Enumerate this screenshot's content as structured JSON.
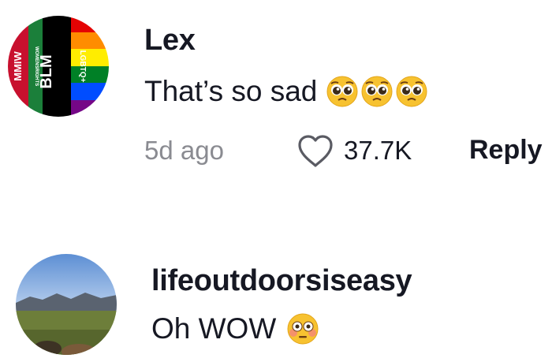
{
  "comments": [
    {
      "username": "Lex",
      "text": "That’s so sad",
      "emojis": [
        "pleading-face",
        "pleading-face",
        "pleading-face"
      ],
      "age": "5d ago",
      "likes": "37.7K",
      "reply_label": "Reply",
      "avatar": {
        "type": "flag-collage",
        "texts": [
          "MMIW",
          "BLM",
          "LGBTQ+",
          "WOMENSRIGHTS"
        ],
        "colors": [
          "#c8102e",
          "#1b7f3a",
          "#000000",
          "#e40303",
          "#ff8c00",
          "#ffed00",
          "#008026",
          "#004dff",
          "#750787"
        ]
      }
    },
    {
      "username": "lifeoutdoorsiseasy",
      "text": "Oh WOW",
      "emojis": [
        "flushed-face"
      ],
      "avatar": {
        "type": "landscape-photo",
        "colors": [
          "#6f9bd8",
          "#a8c4e8",
          "#56606e",
          "#6d7e3a",
          "#4f5d2c"
        ]
      }
    }
  ],
  "icons": {
    "like": "heart-outline-icon"
  },
  "colors": {
    "text_primary": "#161823",
    "text_secondary": "#8a8b91"
  }
}
